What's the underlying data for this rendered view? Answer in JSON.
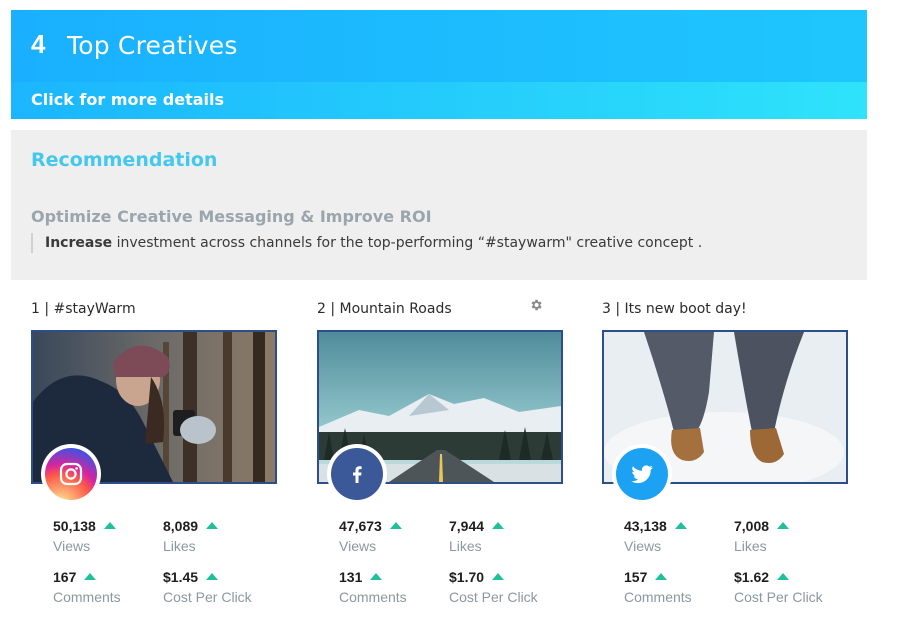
{
  "header": {
    "number": "4",
    "title": "Top Creatives",
    "link": "Click for more details"
  },
  "recommendation": {
    "title": "Recommendation",
    "subtitle": "Optimize Creative Messaging & Improve ROI",
    "body_bold": "Increase",
    "body_text": " investment across channels for the top-performing “#staywarm\" creative concept ."
  },
  "creatives": [
    {
      "title": "1 | #stayWarm",
      "network": "instagram-icon",
      "stats": [
        {
          "value": "50,138",
          "label": "Views"
        },
        {
          "value": "8,089",
          "label": "Likes"
        },
        {
          "value": "167",
          "label": "Comments"
        },
        {
          "value": "$1.45",
          "label": "Cost Per Click"
        }
      ]
    },
    {
      "title": "2 | Mountain Roads",
      "network": "facebook-icon",
      "stats": [
        {
          "value": "47,673",
          "label": "Views"
        },
        {
          "value": "7,944",
          "label": "Likes"
        },
        {
          "value": "131",
          "label": "Comments"
        },
        {
          "value": "$1.70",
          "label": "Cost Per Click"
        }
      ]
    },
    {
      "title": "3 | Its new boot day!",
      "network": "twitter-icon",
      "stats": [
        {
          "value": "43,138",
          "label": "Views"
        },
        {
          "value": "7,008",
          "label": "Likes"
        },
        {
          "value": "157",
          "label": "Comments"
        },
        {
          "value": "$1.62",
          "label": "Cost Per Click"
        }
      ]
    }
  ],
  "colors": {
    "header_gradient_start": "#1bb6ff",
    "header_gradient_end": "#2fe3fb",
    "recommendation_title": "#44c8ee",
    "trend_up": "#22c09a",
    "image_border": "#2c4f8a",
    "facebook": "#3b5998",
    "twitter": "#1da1f2"
  }
}
